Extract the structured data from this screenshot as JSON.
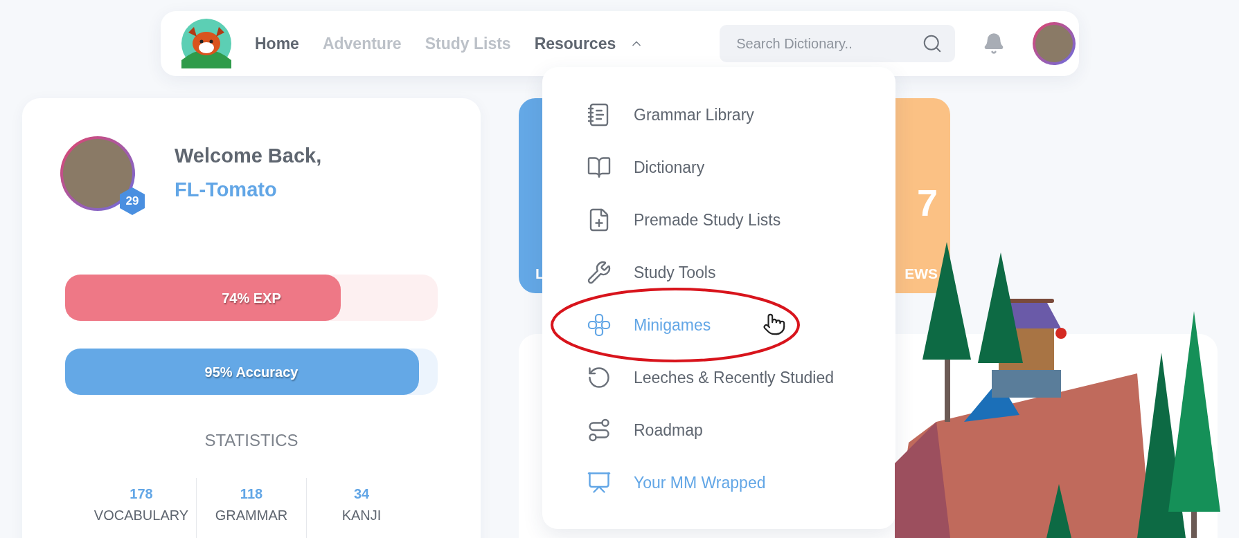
{
  "nav": {
    "items": [
      {
        "label": "Home",
        "selected": true
      },
      {
        "label": "Adventure",
        "selected": false
      },
      {
        "label": "Study Lists",
        "selected": false
      },
      {
        "label": "Resources",
        "selected": true,
        "expanded": true
      }
    ],
    "search": {
      "placeholder": "Search Dictionary.."
    }
  },
  "profile": {
    "level_badge": "29",
    "greeting": "Welcome Back,",
    "username": "FL-Tomato",
    "bars": [
      {
        "label": "74% EXP",
        "level": 0.74,
        "kind": "exp"
      },
      {
        "label": "95% Accuracy",
        "level": 0.95,
        "kind": "accuracy"
      }
    ],
    "statistics_title": "STATISTICS",
    "statistics": [
      {
        "value": "178",
        "label": "VOCABULARY"
      },
      {
        "value": "118",
        "label": "GRAMMAR"
      },
      {
        "value": "34",
        "label": "KANJI"
      }
    ]
  },
  "summary_cards": [
    {
      "kind": "blue",
      "caption": "L"
    },
    {
      "kind": "orange",
      "number": "7",
      "caption": "EWS"
    }
  ],
  "resources_menu": [
    {
      "label": "Grammar Library",
      "active": false
    },
    {
      "label": "Dictionary",
      "active": false
    },
    {
      "label": "Premade Study Lists",
      "active": false
    },
    {
      "label": "Study Tools",
      "active": false
    },
    {
      "label": "Minigames",
      "active": true,
      "circled": true
    },
    {
      "label": "Leeches & Recently Studied",
      "active": false
    },
    {
      "label": "Roadmap",
      "active": false
    },
    {
      "label": "Your MM Wrapped",
      "active": true
    }
  ]
}
